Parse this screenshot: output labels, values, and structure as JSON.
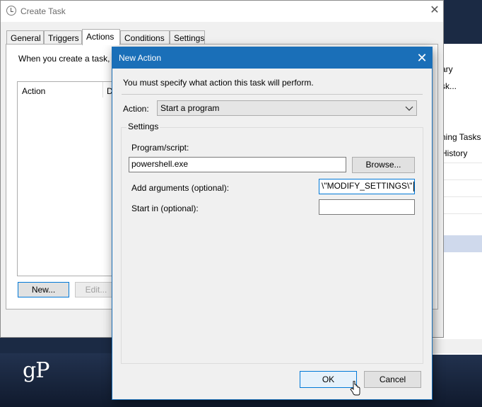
{
  "create_task": {
    "title": "Create Task",
    "close_glyph": "✕",
    "tabs": [
      {
        "label": "General"
      },
      {
        "label": "Triggers"
      },
      {
        "label": "Actions",
        "active": true
      },
      {
        "label": "Conditions"
      },
      {
        "label": "Settings"
      }
    ],
    "description": "When you create a task, y",
    "list_headers": [
      "Action",
      "D"
    ],
    "buttons": {
      "new": "New...",
      "edit": "Edit..."
    }
  },
  "background_window": {
    "items": [
      "ary",
      "sk...",
      "ning Tasks",
      "History"
    ]
  },
  "new_action": {
    "title": "New Action",
    "close_glyph": "✕",
    "instruction": "You must specify what action this task will perform.",
    "action_label": "Action:",
    "action_value": "Start a program",
    "settings_group": "Settings",
    "program_label": "Program/script:",
    "program_value": "powershell.exe",
    "browse_button": "Browse...",
    "arguments_label": "Add arguments (optional):",
    "arguments_value": "\\\"MODIFY_SETTINGS\\\"",
    "start_in_label": "Start in (optional):",
    "start_in_value": "",
    "ok_button": "OK",
    "cancel_button": "Cancel"
  },
  "branding": {
    "logo_text": "gP"
  },
  "colors": {
    "accent": "#1a6fb8",
    "focus": "#0078d7"
  }
}
